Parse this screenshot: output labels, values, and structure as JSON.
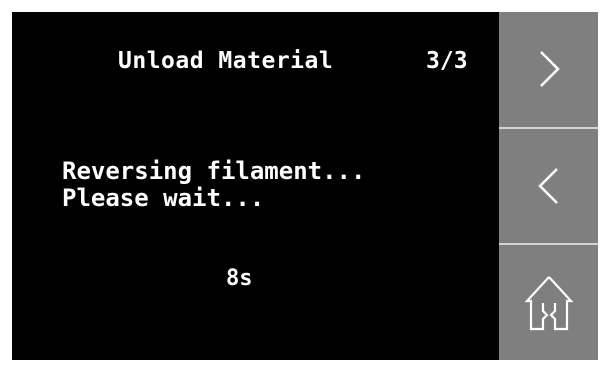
{
  "header": {
    "title": "Unload Material",
    "step": "3/3"
  },
  "message": {
    "line1": "Reversing filament...",
    "line2": "Please wait..."
  },
  "timer": {
    "remaining": "8s"
  },
  "sidebar": {
    "buttons": [
      {
        "name": "next",
        "icon": "chevron-right-icon"
      },
      {
        "name": "back",
        "icon": "chevron-left-icon"
      },
      {
        "name": "home",
        "icon": "home-icon"
      }
    ]
  },
  "colors": {
    "screen_background": "#000000",
    "text": "#ffffff",
    "button_background": "#7f7f7f",
    "button_divider": "#d2d2d2",
    "icon_stroke": "#ffffff"
  }
}
